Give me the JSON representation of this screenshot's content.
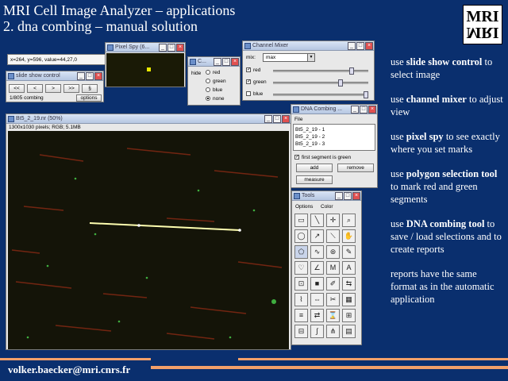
{
  "slide": {
    "title_line1": "MRI Cell Image Analyzer – applications",
    "title_line2": "2. dna combing – manual solution",
    "logo_top": "MRI",
    "logo_bottom": "MRI",
    "email": "volker.baecker@mri.cnrs.fr"
  },
  "bullets": [
    {
      "pre": "use ",
      "bold": "slide show control",
      "post": " to select image"
    },
    {
      "pre": "use ",
      "bold": "channel mixer",
      "post": " to adjust view"
    },
    {
      "pre": "use ",
      "bold": "pixel spy",
      "post": " to see exactly where you set marks"
    },
    {
      "pre": "use ",
      "bold": "polygon selection tool",
      "post": " to mark red and green segments"
    },
    {
      "pre": "use ",
      "bold": "DNA combing tool",
      "post": " to save / load selections and to create reports"
    },
    {
      "pre": "reports have the same format as in the automatic application",
      "bold": "",
      "post": ""
    }
  ],
  "coords": {
    "text": "x=264, y=596, value=44,27,0"
  },
  "slideshow": {
    "title": "slide show control",
    "buttons": [
      "<<",
      "<",
      ">",
      ">>",
      "§"
    ],
    "status": "1/805 combing",
    "options": "options"
  },
  "pixelspy": {
    "title": "Pixel Spy (6..."
  },
  "hide": {
    "title": "C...",
    "label": "hide",
    "options": [
      "red",
      "green",
      "blue",
      "none"
    ],
    "selected": "none"
  },
  "mixer": {
    "title": "Channel Mixer",
    "mix_label": "mix:",
    "mix_value": "max",
    "channels": [
      {
        "name": "red",
        "checked": true,
        "level": 0.82
      },
      {
        "name": "green",
        "checked": true,
        "level": 0.7
      },
      {
        "name": "blue",
        "checked": false,
        "level": 0.98
      }
    ]
  },
  "dna": {
    "title": "DNA Combing ...",
    "menu": "File",
    "items": [
      "Bt5_2_19 - 1",
      "Bt5_2_19 - 2",
      "Bt5_2_19 - 3"
    ],
    "first_green_label": "first segment is green",
    "first_green_checked": true,
    "add": "add",
    "remove": "remove",
    "measure": "measure"
  },
  "image": {
    "title": "Bt5_2_19.nr (50%)",
    "info": "1300x1030 pixels; RGB; 5.1MB"
  },
  "tools": {
    "title": "Tools",
    "menus": [
      "Options",
      "Color"
    ]
  },
  "colors": {
    "background": "#0a2f6e",
    "accent_line": "#f2a06a",
    "segment_line": "#ffffb0"
  }
}
